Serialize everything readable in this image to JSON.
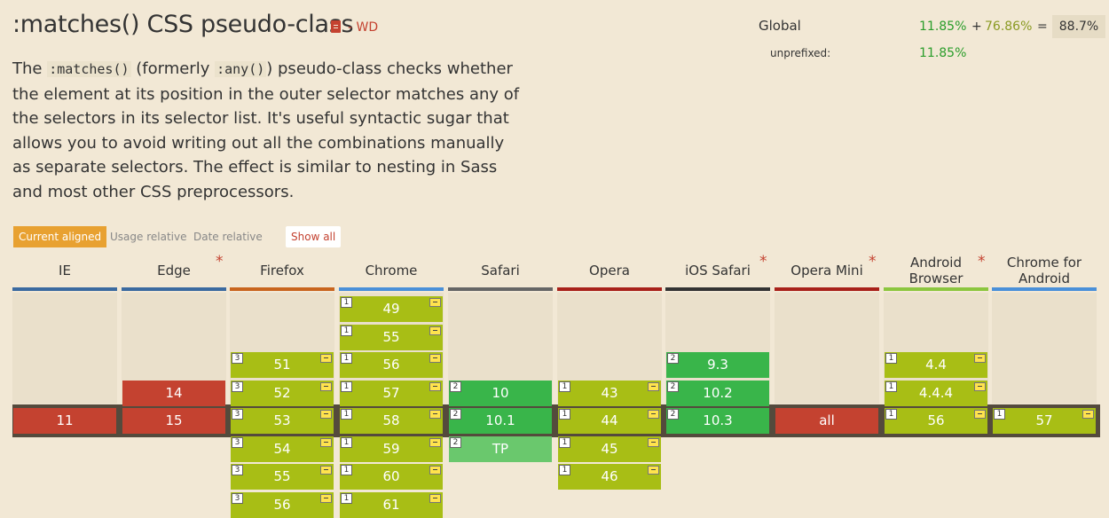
{
  "page": {
    "title": ":matches() CSS pseudo-class",
    "status": "- WD",
    "description_parts": [
      "The ",
      ":matches()",
      " (formerly ",
      ":any()",
      ") pseudo-class checks whether the element at its position in the outer selector matches any of the selectors in its selector list. It's useful syntactic sugar that allows you to avoid writing out all the combinations manually as separate selectors. The effect is similar to nesting in Sass and most other CSS preprocessors."
    ]
  },
  "usage": {
    "global_label": "Global",
    "full": "11.85%",
    "plus": "+",
    "partial": "76.86%",
    "equals": "=",
    "total": "88.7%",
    "unprefixed_label": "unprefixed:",
    "unprefixed": "11.85%"
  },
  "modes": {
    "current": "Current aligned",
    "usage": "Usage relative",
    "date": "Date relative",
    "show_all": "Show all"
  },
  "colors": {
    "full_support": "#39b54a",
    "partial_support": "#a8be15",
    "no_support": "#c44230"
  },
  "browsers": [
    {
      "name": "IE",
      "star": "",
      "bar": "#3b6aa0",
      "rows": [
        {
          "row": 0,
          "v": "11",
          "s": "no",
          "n": "",
          "f": false
        }
      ]
    },
    {
      "name": "Edge",
      "star": "*",
      "bar": "#3b6aa0",
      "rows": [
        {
          "row": -1,
          "v": "14",
          "s": "no",
          "n": "",
          "f": false
        },
        {
          "row": 0,
          "v": "15",
          "s": "no",
          "n": "",
          "f": false
        }
      ]
    },
    {
      "name": "Firefox",
      "star": "",
      "bar": "#c9651e",
      "rows": [
        {
          "row": -2,
          "v": "51",
          "s": "partial",
          "n": "3",
          "f": true
        },
        {
          "row": -1,
          "v": "52",
          "s": "partial",
          "n": "3",
          "f": true
        },
        {
          "row": 0,
          "v": "53",
          "s": "partial",
          "n": "3",
          "f": true
        },
        {
          "row": 1,
          "v": "54",
          "s": "partial",
          "n": "3",
          "f": true
        },
        {
          "row": 2,
          "v": "55",
          "s": "partial",
          "n": "3",
          "f": true
        },
        {
          "row": 3,
          "v": "56",
          "s": "partial",
          "n": "3",
          "f": true
        }
      ]
    },
    {
      "name": "Chrome",
      "star": "",
      "bar": "#4a90d9",
      "rows": [
        {
          "row": -4,
          "v": "49",
          "s": "partial",
          "n": "1",
          "f": true
        },
        {
          "row": -3,
          "v": "55",
          "s": "partial",
          "n": "1",
          "f": true
        },
        {
          "row": -2,
          "v": "56",
          "s": "partial",
          "n": "1",
          "f": true
        },
        {
          "row": -1,
          "v": "57",
          "s": "partial",
          "n": "1",
          "f": true
        },
        {
          "row": 0,
          "v": "58",
          "s": "partial",
          "n": "1",
          "f": true
        },
        {
          "row": 1,
          "v": "59",
          "s": "partial",
          "n": "1",
          "f": true
        },
        {
          "row": 2,
          "v": "60",
          "s": "partial",
          "n": "1",
          "f": true
        },
        {
          "row": 3,
          "v": "61",
          "s": "partial",
          "n": "1",
          "f": true
        }
      ]
    },
    {
      "name": "Safari",
      "star": "",
      "bar": "#666666",
      "rows": [
        {
          "row": -1,
          "v": "10",
          "s": "yes",
          "n": "2",
          "f": false
        },
        {
          "row": 0,
          "v": "10.1",
          "s": "yes",
          "n": "2",
          "f": false
        },
        {
          "row": 1,
          "v": "TP",
          "s": "tp",
          "n": "2",
          "f": false
        }
      ]
    },
    {
      "name": "Opera",
      "star": "",
      "bar": "#a8211a",
      "rows": [
        {
          "row": -1,
          "v": "43",
          "s": "partial",
          "n": "1",
          "f": true
        },
        {
          "row": 0,
          "v": "44",
          "s": "partial",
          "n": "1",
          "f": true
        },
        {
          "row": 1,
          "v": "45",
          "s": "partial",
          "n": "1",
          "f": true
        },
        {
          "row": 2,
          "v": "46",
          "s": "partial",
          "n": "1",
          "f": true
        }
      ]
    },
    {
      "name": "iOS Safari",
      "star": "*",
      "bar": "#333333",
      "rows": [
        {
          "row": -2,
          "v": "9.3",
          "s": "yes",
          "n": "2",
          "f": false
        },
        {
          "row": -1,
          "v": "10.2",
          "s": "yes",
          "n": "2",
          "f": false
        },
        {
          "row": 0,
          "v": "10.3",
          "s": "yes",
          "n": "2",
          "f": false
        }
      ]
    },
    {
      "name": "Opera Mini",
      "star": "*",
      "bar": "#a8211a",
      "rows": [
        {
          "row": 0,
          "v": "all",
          "s": "no",
          "n": "",
          "f": false
        }
      ]
    },
    {
      "name": "Android\nBrowser",
      "star": "*",
      "bar": "#8cc63f",
      "rows": [
        {
          "row": -2,
          "v": "4.4",
          "s": "partial",
          "n": "1",
          "f": true
        },
        {
          "row": -1,
          "v": "4.4.4",
          "s": "partial",
          "n": "1",
          "f": true
        },
        {
          "row": 0,
          "v": "56",
          "s": "partial",
          "n": "1",
          "f": true
        }
      ]
    },
    {
      "name": "Chrome for\nAndroid",
      "star": "",
      "bar": "#4a90d9",
      "rows": [
        {
          "row": 0,
          "v": "57",
          "s": "partial",
          "n": "1",
          "f": true
        }
      ]
    }
  ]
}
